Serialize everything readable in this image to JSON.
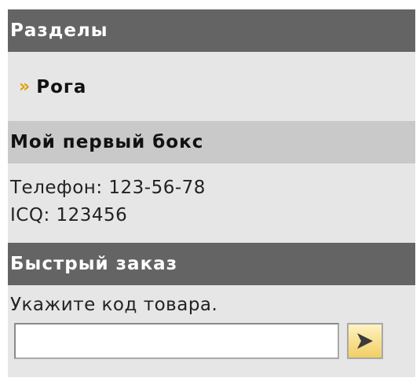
{
  "sections": {
    "title": "Разделы",
    "items": [
      {
        "bullet": "»",
        "label": "Рога"
      }
    ]
  },
  "first_box": {
    "title": "Мой первый бокс",
    "phone": "Телефон: 123-56-78",
    "icq": "ICQ: 123456"
  },
  "quick_order": {
    "title": "Быстрый заказ",
    "prompt": "Укажите код товара.",
    "code_value": "",
    "submit_icon": "play-arrow-icon"
  },
  "colors": {
    "header_dark": "#646464",
    "header_light": "#c9c9c9",
    "box_background": "#e6e6e6",
    "bullet": "#e0a100",
    "button_fill": "#f1cf63"
  }
}
